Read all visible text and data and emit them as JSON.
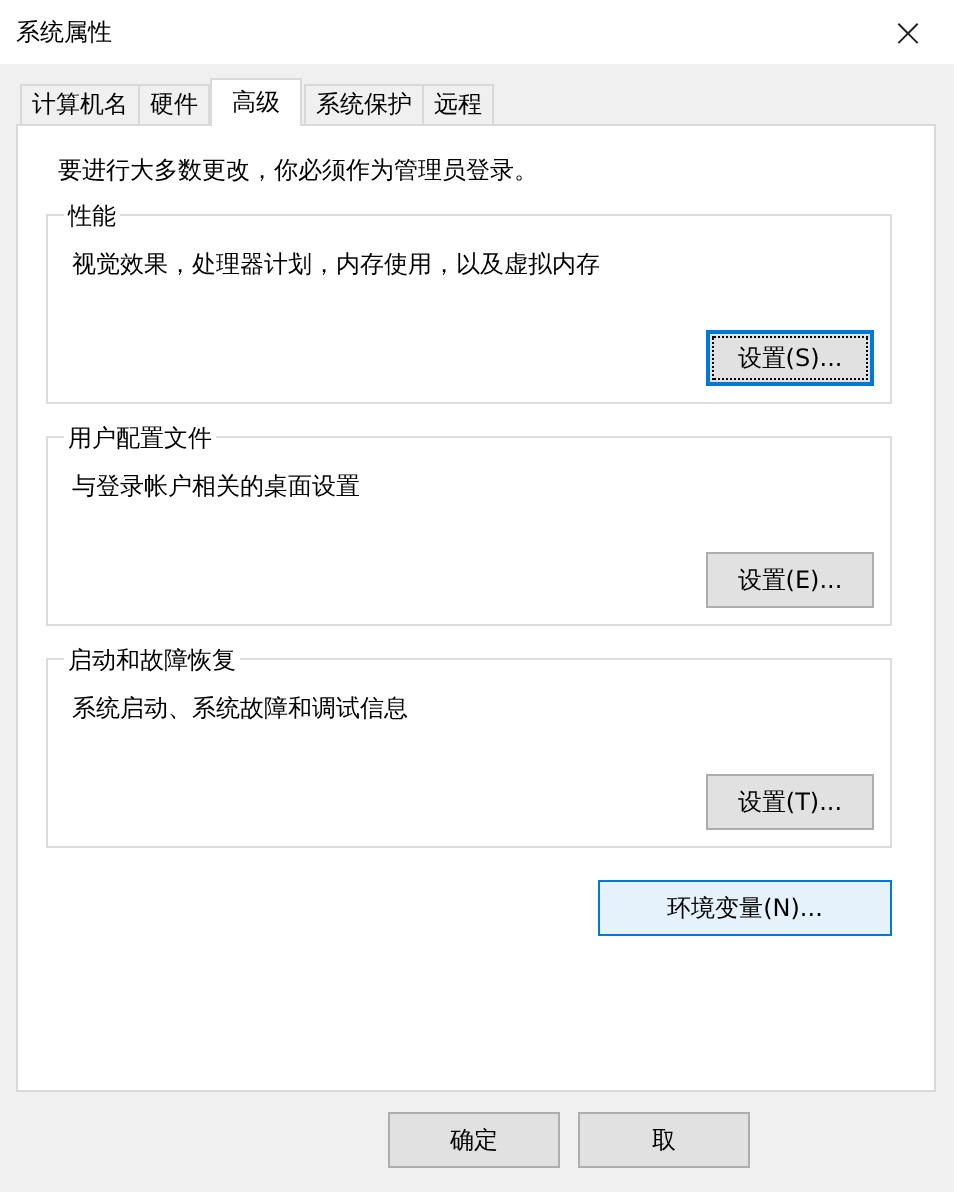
{
  "window": {
    "title": "系统属性",
    "close": "×"
  },
  "tabs": [
    {
      "label": "计算机名",
      "selected": false
    },
    {
      "label": "硬件",
      "selected": false
    },
    {
      "label": "高级",
      "selected": true
    },
    {
      "label": "系统保护",
      "selected": false
    },
    {
      "label": "远程",
      "selected": false
    }
  ],
  "notice": "要进行大多数更改，你必须作为管理员登录。",
  "groups": [
    {
      "title": "性能",
      "description": "视觉效果，处理器计划，内存使用，以及虚拟内存",
      "button": {
        "label": "设置(S)...",
        "focused": true
      }
    },
    {
      "title": "用户配置文件",
      "description": "与登录帐户相关的桌面设置",
      "button": {
        "label": "设置(E)...",
        "focused": false
      }
    },
    {
      "title": "启动和故障恢复",
      "description": "系统启动、系统故障和调试信息",
      "button": {
        "label": "设置(T)...",
        "focused": false
      }
    }
  ],
  "env_button": {
    "label": "环境变量(N)...",
    "hovered": true
  },
  "dialog_buttons": [
    {
      "label": "确定"
    },
    {
      "label": "取"
    }
  ]
}
